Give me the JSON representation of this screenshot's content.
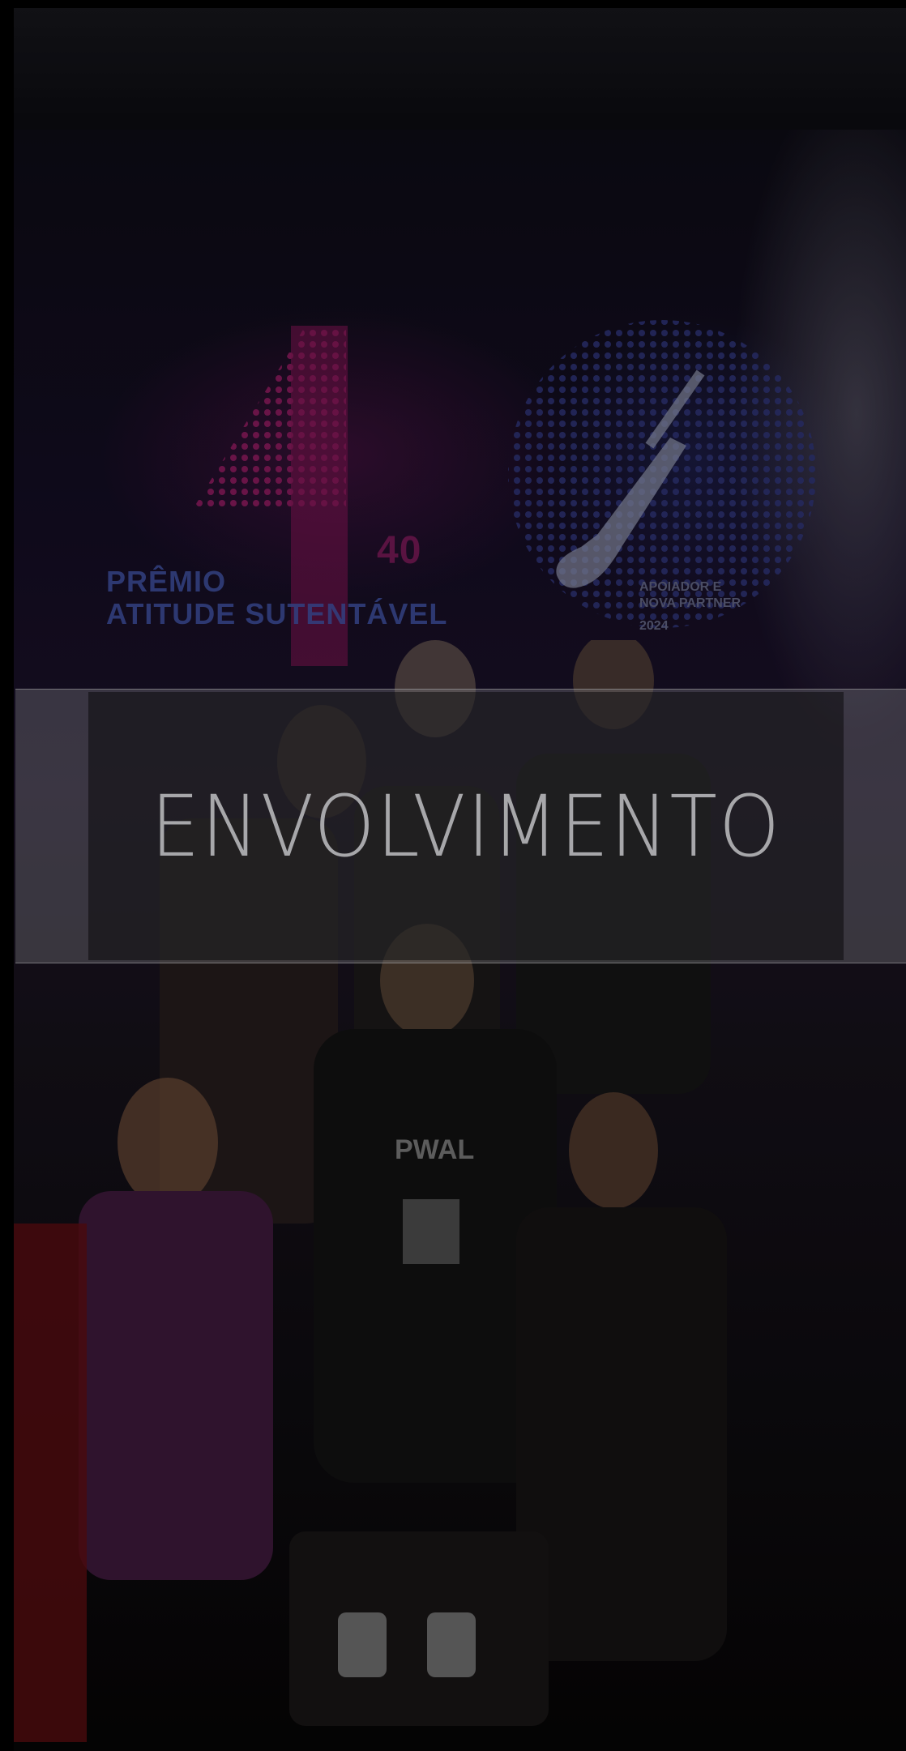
{
  "hero": {
    "title": "ENVOLVIMENTO",
    "photo_alt": "Group photo at award ceremony stage",
    "stage_backdrop": {
      "award_line_1": "PRÊMIO",
      "award_line_2": "ATITUDE SUTENTÁVEL",
      "badge_number": "40",
      "side_line_1": "APOIADOR E",
      "side_line_2": "NOVA PARTNER",
      "side_line_3": "2024"
    },
    "shirt_text": "PWAL"
  },
  "colors": {
    "overlay_band": "#78787d",
    "title_text": "#a7a7aa",
    "stage_pink": "#b0186c",
    "stage_blue": "#3e4f9c"
  }
}
